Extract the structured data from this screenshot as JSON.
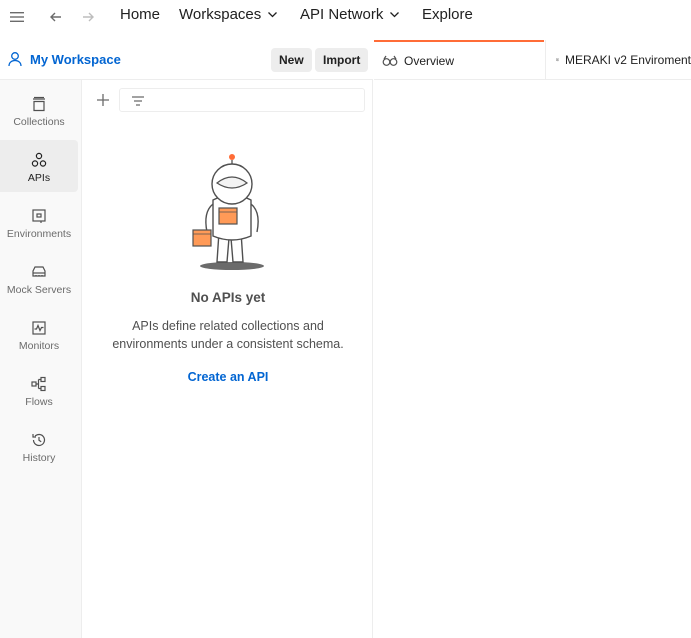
{
  "topnav": {
    "home": "Home",
    "workspaces": "Workspaces",
    "api_network": "API Network",
    "explore": "Explore"
  },
  "workspace": {
    "title": "My Workspace",
    "new_label": "New",
    "import_label": "Import"
  },
  "sidebar": {
    "items": [
      {
        "label": "Collections",
        "icon": "collections-icon"
      },
      {
        "label": "APIs",
        "icon": "apis-icon"
      },
      {
        "label": "Environments",
        "icon": "environments-icon"
      },
      {
        "label": "Mock Servers",
        "icon": "mock-servers-icon"
      },
      {
        "label": "Monitors",
        "icon": "monitors-icon"
      },
      {
        "label": "Flows",
        "icon": "flows-icon"
      },
      {
        "label": "History",
        "icon": "history-icon"
      }
    ],
    "active": "APIs"
  },
  "panel": {
    "empty_title": "No APIs yet",
    "empty_desc": "APIs define related collections and environments under a consistent schema.",
    "create_link": "Create an API"
  },
  "tabs": [
    {
      "label": "Overview",
      "icon": "overview-icon"
    },
    {
      "label": "MERAKI v2 Enviroment",
      "icon": "environment-icon"
    }
  ],
  "colors": {
    "accent": "#ff6c37",
    "link": "#0265d2",
    "annotation": "#e0001b"
  }
}
